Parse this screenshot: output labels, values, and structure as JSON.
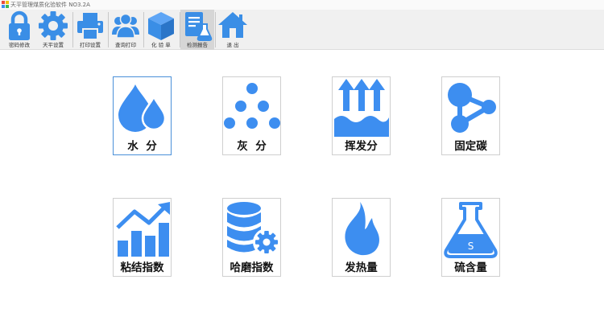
{
  "window": {
    "title": "天平管理煤质化验软件 NO3.2A"
  },
  "theme": {
    "icon_blue": "#3d8ef0",
    "toolbar_blue": "#3a8ee6"
  },
  "toolbar": {
    "items": [
      {
        "label": "密码修改",
        "icon": "lock-icon"
      },
      {
        "label": "天平设置",
        "icon": "gear-icon"
      },
      {
        "label": "打印设置",
        "icon": "printer-icon"
      },
      {
        "label": "查询打印",
        "icon": "users-icon"
      },
      {
        "label": "化  验  单",
        "icon": "box-icon"
      },
      {
        "label": "检测报告",
        "icon": "report-flask-icon"
      },
      {
        "label": "退   出",
        "icon": "home-icon"
      }
    ]
  },
  "tiles": [
    {
      "label": "水  分",
      "icon": "water-drops-icon"
    },
    {
      "label": "灰  分",
      "icon": "ash-dots-icon"
    },
    {
      "label": "挥发分",
      "icon": "volatile-arrows-icon"
    },
    {
      "label": "固定碳",
      "icon": "molecule-icon"
    },
    {
      "label": "粘结指数",
      "icon": "bar-chart-icon"
    },
    {
      "label": "哈磨指数",
      "icon": "database-gear-icon"
    },
    {
      "label": "发热量",
      "icon": "flame-icon"
    },
    {
      "label": "硫含量",
      "icon": "flask-icon"
    }
  ]
}
